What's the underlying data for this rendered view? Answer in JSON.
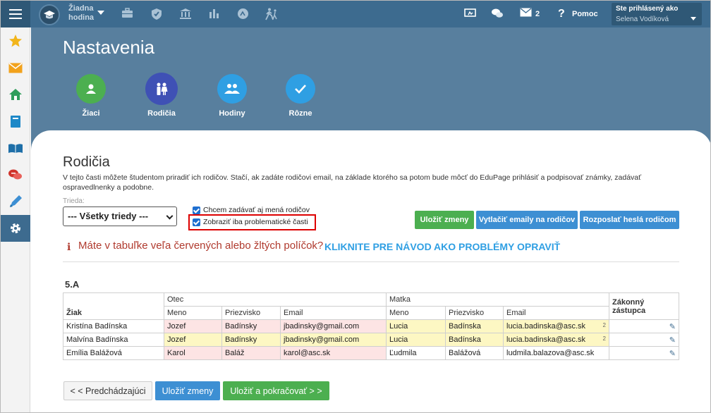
{
  "topbar": {
    "lesson": [
      "Žiadna",
      "hodina"
    ],
    "messages_count": "2",
    "help_label": "Pomoc",
    "logged_label": "Ste prihlásený ako",
    "user_name": "Selena Vodíková"
  },
  "page": {
    "title": "Nastavenia",
    "nav": [
      {
        "label": "Žiaci",
        "color": "#4caf50",
        "icon": "person-icon"
      },
      {
        "label": "Rodičia",
        "color": "#3f51b5",
        "icon": "parents-icon"
      },
      {
        "label": "Hodiny",
        "color": "#2f9fe3",
        "icon": "group-icon"
      },
      {
        "label": "Rôzne",
        "color": "#2f9fe3",
        "icon": "check-icon"
      }
    ]
  },
  "section": {
    "title": "Rodičia",
    "description": "V tejto časti môžete študentom priradiť ich rodičov. Stačí, ak zadáte rodičovi email, na základe ktorého sa potom bude môcť do EduPage prihlásiť a podpisovať známky, zadávať ospravedlnenky a podobne.",
    "trieda_label": "Trieda:",
    "trieda_value": "--- Všetky triedy ---",
    "checkbox_names": "Chcem zadávať aj mená rodičov",
    "checkbox_problems": "Zobraziť iba problematické časti",
    "btn_save": "Uložiť zmeny",
    "btn_print": "Vytlačiť emaily na rodičov",
    "btn_send": "Rozposlať heslá rodičom",
    "warning": "Máte v tabuľke veľa červených alebo žltých políčok?",
    "howto": "KLIKNITE PRE NÁVOD AKO PROBLÉMY OPRAVIŤ",
    "class_name": "5.A"
  },
  "table": {
    "h_student": "Žiak",
    "h_father": "Otec",
    "h_mother": "Matka",
    "h_guardian": "Zákonný zástupca",
    "h_name": "Meno",
    "h_surname": "Priezvisko",
    "h_email": "Email",
    "rows": [
      {
        "student": "Kristína Badínska",
        "f_name": "Jozef",
        "f_surname": "Badínsky",
        "f_email": "jbadinsky@gmail.com",
        "m_name": "Lucia",
        "m_surname": "Badínska",
        "m_email": "lucia.badinska@asc.sk",
        "m_count": "2"
      },
      {
        "student": "Malvína Badínska",
        "f_name": "Jozef",
        "f_surname": "Badínsky",
        "f_email": "jbadinsky@gmail.com",
        "m_name": "Lucia",
        "m_surname": "Badínska",
        "m_email": "lucia.badinska@asc.sk",
        "m_count": "2"
      },
      {
        "student": "Emília Balážová",
        "f_name": "Karol",
        "f_surname": "Baláž",
        "f_email": "karol@asc.sk",
        "m_name": "Ľudmila",
        "m_surname": "Balážová",
        "m_email": "ludmila.balazova@asc.sk",
        "m_count": ""
      }
    ]
  },
  "footer": {
    "prev": "< < Predchádzajúci",
    "save": "Uložiť zmeny",
    "save_continue": "Uložiť a pokračovať > >"
  }
}
